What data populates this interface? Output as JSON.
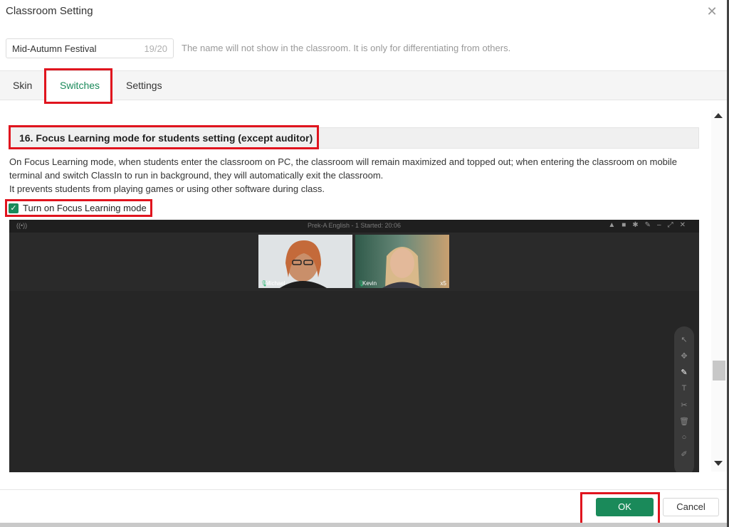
{
  "dialog": {
    "title": "Classroom Setting"
  },
  "name_field": {
    "value": "Mid-Autumn Festival",
    "counter": "19/20",
    "hint": "The name will not show in the classroom. It is only for differentiating from others."
  },
  "tabs": [
    {
      "label": "Skin",
      "active": false
    },
    {
      "label": "Switches",
      "active": true
    },
    {
      "label": "Settings",
      "active": false
    }
  ],
  "section": {
    "title": "16. Focus Learning mode for students setting (except auditor)",
    "desc_lines": [
      "On Focus Learning mode, when students enter the classroom on PC, the classroom will remain maximized and topped out; when entering the classroom on mobile",
      "terminal and switch ClassIn to run in background, they will automatically exit the classroom.",
      "It prevents students from playing games or using other software during class."
    ],
    "checkbox_label": "Turn on Focus Learning mode",
    "checkbox_checked": true
  },
  "preview": {
    "title": "Prek-A English - 1    Started: 20:06",
    "signal": "((•))",
    "videos": [
      {
        "name": "Michael"
      },
      {
        "name": "Kevin",
        "trophy": "x5"
      }
    ]
  },
  "footer": {
    "ok_label": "OK",
    "cancel_label": "Cancel"
  },
  "colors": {
    "accent": "#1a8a5a",
    "highlight": "#e0141e"
  },
  "icons": [
    "close-icon",
    "checkmark-icon",
    "scroll-up-icon",
    "scroll-down-icon"
  ]
}
